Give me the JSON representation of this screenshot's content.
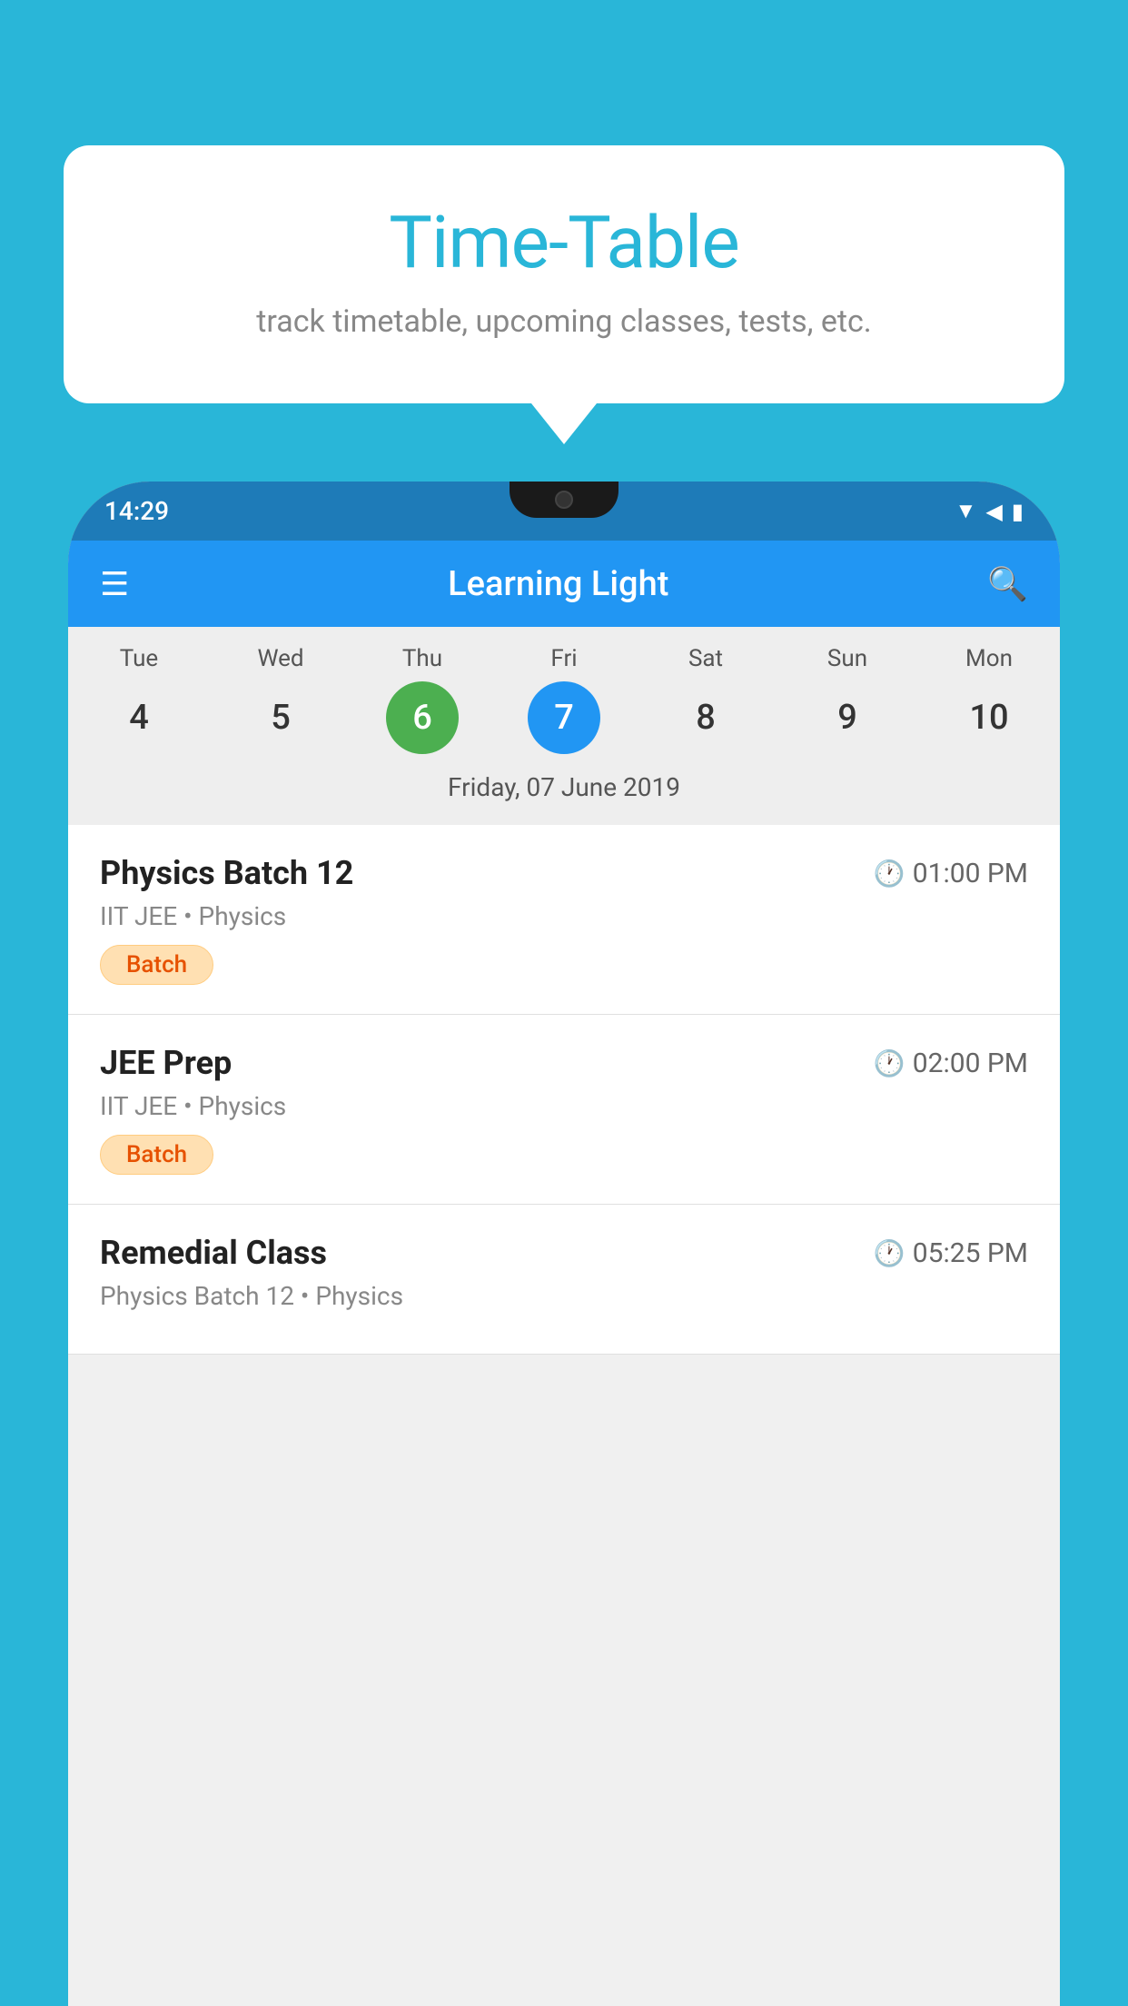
{
  "background_color": "#29b6d8",
  "tooltip": {
    "title": "Time-Table",
    "subtitle": "track timetable, upcoming classes, tests, etc."
  },
  "phone": {
    "status_bar": {
      "time": "14:29",
      "icons": [
        "wifi",
        "signal",
        "battery"
      ]
    },
    "app_bar": {
      "title": "Learning Light",
      "menu_label": "☰",
      "search_label": "🔍"
    },
    "calendar": {
      "days": [
        "Tue",
        "Wed",
        "Thu",
        "Fri",
        "Sat",
        "Sun",
        "Mon"
      ],
      "dates": [
        "4",
        "5",
        "6",
        "7",
        "8",
        "9",
        "10"
      ],
      "today_index": 2,
      "selected_index": 3,
      "date_label": "Friday, 07 June 2019"
    },
    "schedule": [
      {
        "title": "Physics Batch 12",
        "time": "01:00 PM",
        "subtitle": "IIT JEE • Physics",
        "badge": "Batch"
      },
      {
        "title": "JEE Prep",
        "time": "02:00 PM",
        "subtitle": "IIT JEE • Physics",
        "badge": "Batch"
      },
      {
        "title": "Remedial Class",
        "time": "05:25 PM",
        "subtitle": "Physics Batch 12 • Physics",
        "badge": ""
      }
    ]
  }
}
